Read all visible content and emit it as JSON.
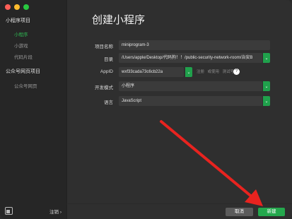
{
  "sidebar": {
    "section_mini": "小程序项目",
    "items": [
      {
        "label": "小程序",
        "active": true
      },
      {
        "label": "小游戏",
        "active": false
      },
      {
        "label": "代码片段",
        "active": false
      }
    ],
    "section_official": "公众号网页项目",
    "official_item": "公众号网页",
    "logout": "注销 ›"
  },
  "main": {
    "title": "创建小程序",
    "fields": {
      "project_name_label": "项目名称",
      "project_name_value": "miniprogram-3",
      "dir_label": "目录",
      "dir_value": "/Users/apple/Desktop/代码狗！！/public-security-network-room/治安B",
      "appid_label": "AppID",
      "appid_value": "wxf33cada73c6cb22a",
      "appid_links": [
        "注册",
        "或使用",
        "测试号"
      ],
      "dev_mode_label": "开发模式",
      "dev_mode_value": "小程序",
      "lang_label": "语言",
      "lang_value": "JavaScript"
    }
  },
  "footer": {
    "cancel": "取消",
    "create": "新建"
  },
  "colors": {
    "accent": "#24a84d",
    "annotation_arrow": "#e8231f"
  }
}
